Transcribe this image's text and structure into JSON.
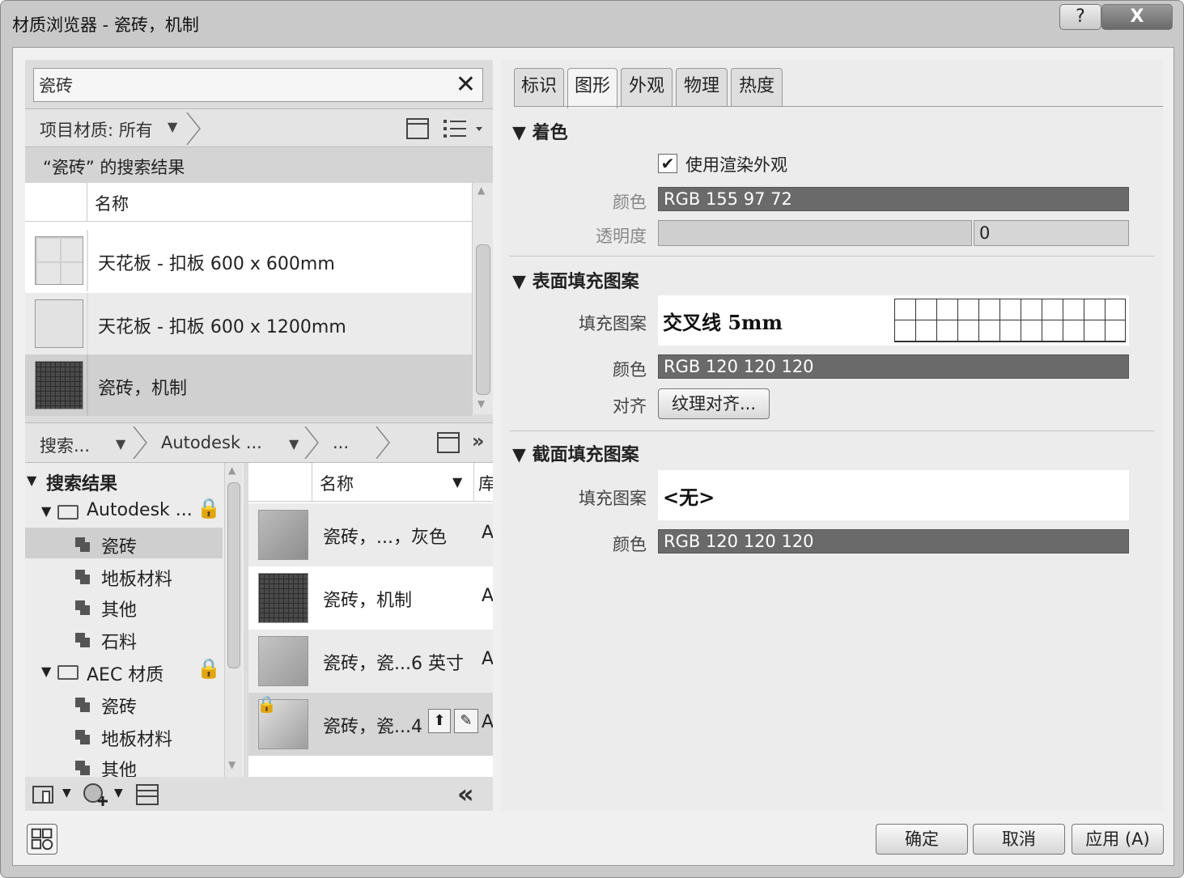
{
  "window": {
    "title": "材质浏览器 - 瓷砖，机制",
    "help_label": "?",
    "close_label": "X"
  },
  "search": {
    "value": "瓷砖",
    "clear_label": "✕"
  },
  "project_bar": {
    "filter_label": "项目材质: 所有"
  },
  "results_header": "“瓷砖” 的搜索结果",
  "project_list": {
    "column_name": "名称",
    "items": [
      {
        "label": "天花板 - 扣板 600 x 600mm"
      },
      {
        "label": "天花板 - 扣板 600 x 1200mm"
      },
      {
        "label": "瓷砖，机制",
        "selected": true
      }
    ]
  },
  "library_bar": {
    "crumbs": [
      "搜索...",
      "Autodesk ...",
      "..."
    ],
    "more_label": "»"
  },
  "tree": {
    "root": "搜索结果",
    "groups": [
      {
        "label": "Autodesk ...",
        "items": [
          "瓷砖",
          "地板材料",
          "其他",
          "石料"
        ]
      },
      {
        "label": "AEC 材质",
        "items": [
          "瓷砖",
          "地板材料",
          "其他"
        ]
      }
    ]
  },
  "material_list": {
    "col_name": "名称",
    "col_lib": "库",
    "items": [
      {
        "label": "瓷砖，...，灰色",
        "lib": "A"
      },
      {
        "label": "瓷砖，机制",
        "lib": "A"
      },
      {
        "label": "瓷砖，瓷...6 英寸",
        "lib": "A"
      },
      {
        "label": "瓷砖，瓷...4",
        "lib": "A"
      }
    ]
  },
  "bottom_tools": {
    "collapse_label": "«"
  },
  "tabs": [
    "标识",
    "图形",
    "外观",
    "物理",
    "热度"
  ],
  "active_tab": "图形",
  "shading": {
    "title": "▼ 着色",
    "use_render_label": "使用渲染外观",
    "use_render_checked": true,
    "color_label": "颜色",
    "color_value": "RGB 155 97 72",
    "transparency_label": "透明度",
    "transparency_value": "0"
  },
  "surface_pattern": {
    "title": "▼ 表面填充图案",
    "pattern_label": "填充图案",
    "pattern_value": "交叉线 5mm",
    "color_label": "颜色",
    "color_value": "RGB 120 120 120",
    "align_label": "对齐",
    "align_button": "纹理对齐..."
  },
  "cut_pattern": {
    "title": "▼ 截面填充图案",
    "pattern_label": "填充图案",
    "pattern_value": "<无>",
    "color_label": "颜色",
    "color_value": "RGB 120 120 120"
  },
  "footer": {
    "ok": "确定",
    "cancel": "取消",
    "apply": "应用 (A)"
  }
}
